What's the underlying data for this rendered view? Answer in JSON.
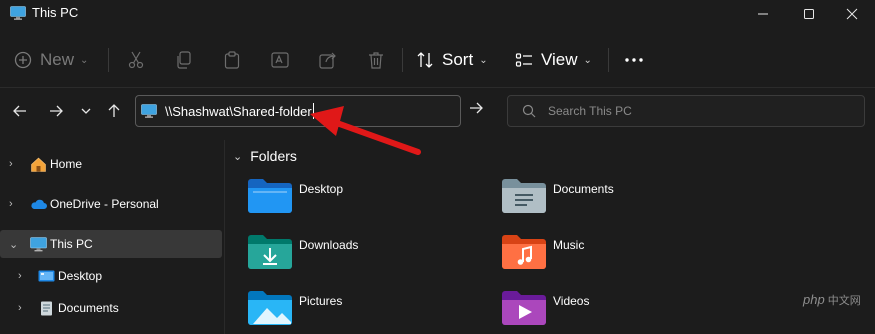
{
  "window": {
    "title": "This PC",
    "icon": "monitor-icon"
  },
  "toolbar": {
    "new_label": "New",
    "sort_label": "Sort",
    "view_label": "View",
    "icons": [
      "cut-icon",
      "copy-icon",
      "paste-icon",
      "rename-icon",
      "share-icon",
      "delete-icon",
      "more-icon"
    ]
  },
  "address": {
    "path": "\\\\Shashwat\\Shared-folder"
  },
  "search": {
    "placeholder": "Search This PC"
  },
  "sidebar": {
    "items": [
      {
        "label": "Home",
        "icon": "home-icon"
      },
      {
        "label": "OneDrive - Personal",
        "icon": "cloud-icon"
      },
      {
        "label": "This PC",
        "icon": "monitor-icon",
        "selected": true
      },
      {
        "label": "Desktop",
        "icon": "desktop-folder-icon"
      },
      {
        "label": "Documents",
        "icon": "documents-folder-icon"
      }
    ]
  },
  "main": {
    "section_title": "Folders",
    "folders": [
      {
        "label": "Desktop",
        "icon": "desktop-folder-icon"
      },
      {
        "label": "Documents",
        "icon": "documents-folder-icon"
      },
      {
        "label": "Downloads",
        "icon": "downloads-folder-icon"
      },
      {
        "label": "Music",
        "icon": "music-folder-icon"
      },
      {
        "label": "Pictures",
        "icon": "pictures-folder-icon"
      },
      {
        "label": "Videos",
        "icon": "videos-folder-icon"
      }
    ]
  },
  "watermark": {
    "text": "php",
    "suffix": "中文网"
  },
  "colors": {
    "background": "#1c1c1c",
    "selection": "#383838",
    "accent_red": "#e01818"
  }
}
